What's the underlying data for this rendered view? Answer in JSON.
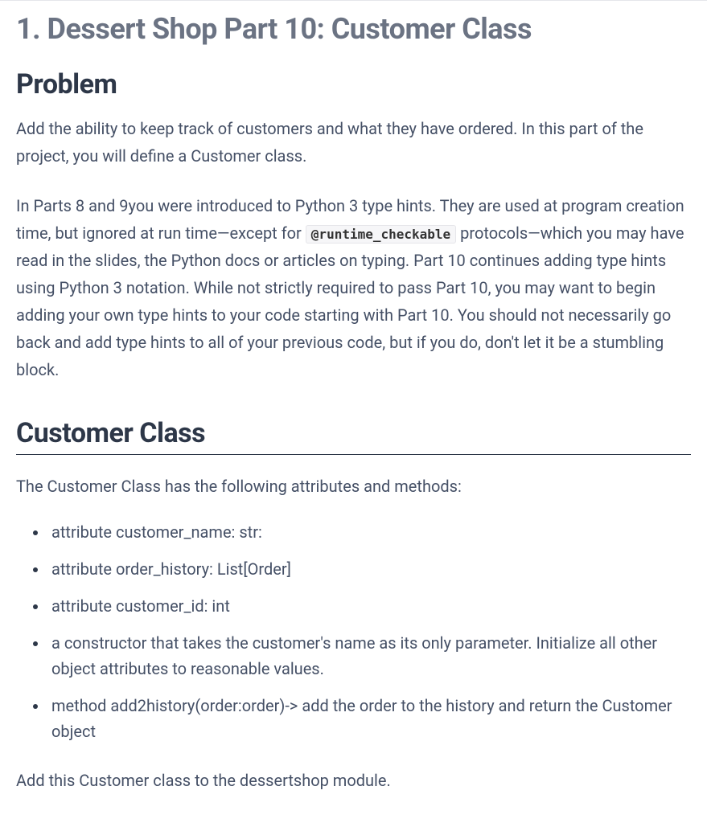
{
  "title": "1. Dessert Shop Part 10: Customer Class",
  "problem": {
    "heading": "Problem",
    "para1": "Add the ability to keep track of customers and what they have ordered. In this part of the project, you will define a Customer class.",
    "para2_pre": "In Parts 8 and 9you were introduced to Python 3 type hints. They are used at program creation time, but ignored at run time—except for ",
    "code": "@runtime_checkable",
    "para2_post": " protocols—which you may have read in the slides, the Python docs or articles on typing. Part 10 continues adding type hints using Python 3 notation. While not strictly required to pass Part 10, you may want to begin adding your own type hints to your code starting with Part 10. You should not necessarily go back and add type hints to all of your previous code, but if you do, don't let it be a stumbling block."
  },
  "customer": {
    "heading": "Customer Class",
    "intro": "The Customer Class has the following attributes and methods:",
    "items": [
      "attribute customer_name: str:",
      "attribute order_history: List[Order]",
      "attribute customer_id: int",
      "a constructor that takes the customer's name as its only parameter. Initialize all other object attributes to reasonable values.",
      "method add2history(order:order)-> add the order to the history and return the Customer object"
    ],
    "footer": "Add this Customer class to the dessertshop module."
  }
}
